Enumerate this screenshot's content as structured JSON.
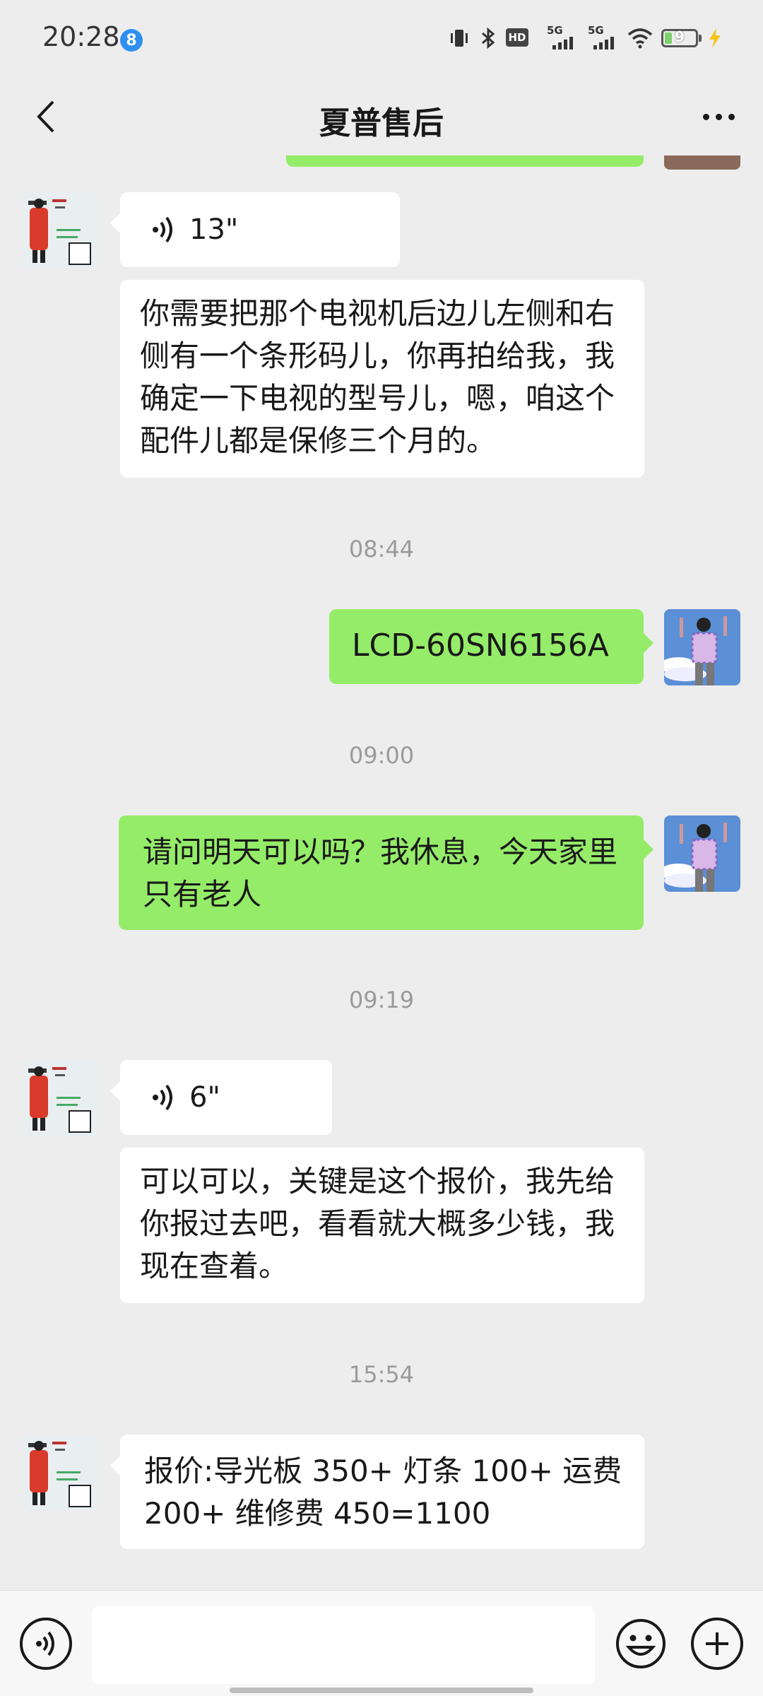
{
  "status_bar": {
    "time": "20:28",
    "notification_badge": "8",
    "icons": [
      "vibrate-icon",
      "bluetooth-icon",
      "hd-icon",
      "5g-signal-icon",
      "5g-signal-icon",
      "wifi-icon",
      "battery-icon",
      "charging-icon"
    ],
    "hd_label": "HD",
    "sim1_label": "5G",
    "sim2_label": "5G",
    "battery_level": "9"
  },
  "header": {
    "title": "夏普售后",
    "back_icon": "chevron-left-icon",
    "more_icon": "more-icon"
  },
  "messages": {
    "m1_voice_duration": "13\"",
    "m2_text": "你需要把那个电视机后边儿左侧和右侧有一个条形码儿，你再拍给我，我确定一下电视的型号儿，嗯，咱这个配件儿都是保修三个月的。",
    "t1": "08:44",
    "m3_text": "LCD-60SN6156A",
    "t2": "09:00",
    "m4_text": "请问明天可以吗？我休息，今天家里只有老人",
    "t3": "09:19",
    "m5_voice_duration": "6\"",
    "m6_text": "可以可以，关键是这个报价，我先给你报过去吧，看看就大概多少钱，我现在查着。",
    "t4": "15:54",
    "m7_text": "报价:导光板 350+ 灯条 100+ 运费 200+ 维修费 450=1100"
  },
  "colors": {
    "sent_bubble": "#95ec69",
    "received_bubble": "#ffffff",
    "background": "#ededed"
  },
  "input_bar": {
    "voice_icon": "voice-mode-icon",
    "emoji_icon": "emoji-icon",
    "plus_icon": "plus-icon",
    "text_value": ""
  }
}
